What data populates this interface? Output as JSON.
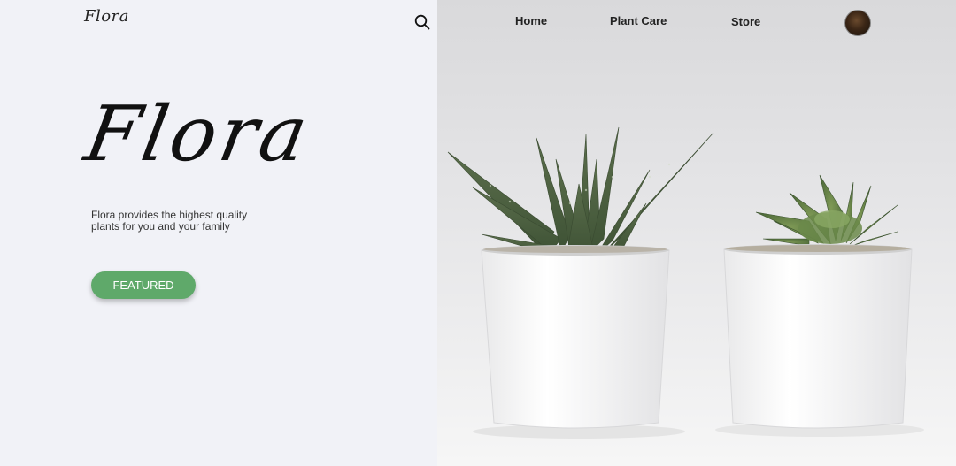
{
  "brand": {
    "name": "Flora"
  },
  "header": {
    "search_icon": "search-icon",
    "nav": [
      {
        "label": "Home"
      },
      {
        "label": "Plant Care"
      },
      {
        "label": "Store"
      }
    ],
    "avatar_icon": "user-avatar"
  },
  "hero": {
    "title": "Flora",
    "description": "Flora provides the highest quality plants for you and your family",
    "cta_label": "FEATURED"
  },
  "colors": {
    "accent": "#5fa96a",
    "left_background": "#f1f2f7"
  }
}
